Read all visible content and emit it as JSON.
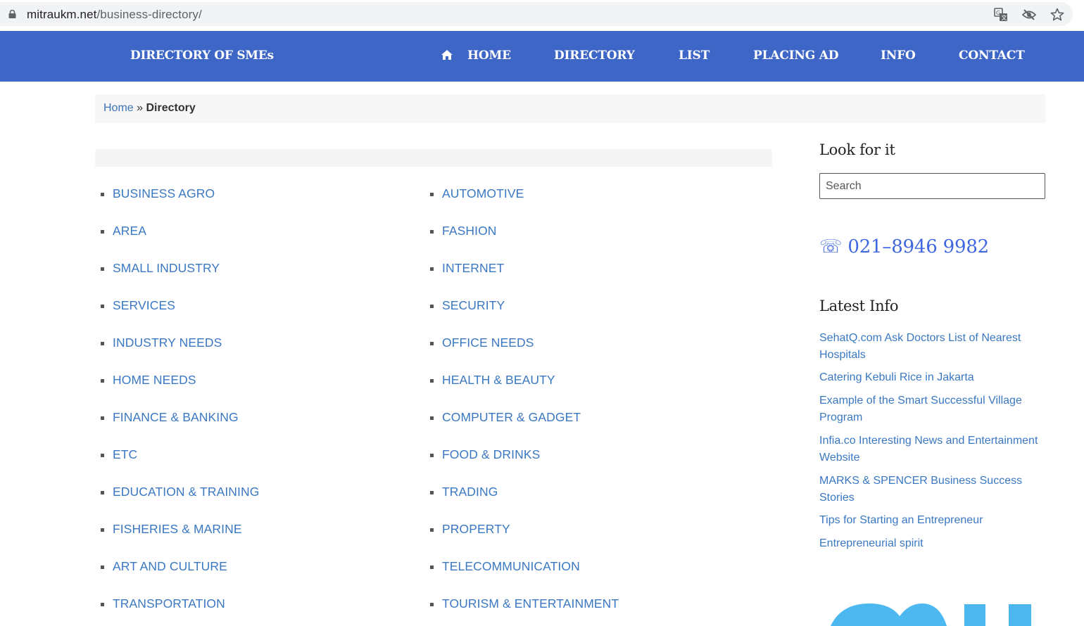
{
  "browser": {
    "url_domain": "mitraukm.net",
    "url_path": "/business-directory/"
  },
  "header": {
    "site_title": "DIRECTORY OF SMEs",
    "nav": [
      "HOME",
      "DIRECTORY",
      "LIST",
      "PLACING AD",
      "INFO",
      "CONTACT"
    ]
  },
  "breadcrumb": {
    "home": "Home",
    "separator": "»",
    "current": "Directory"
  },
  "categories": {
    "left": [
      "BUSINESS AGRO",
      "AREA",
      "SMALL INDUSTRY",
      "SERVICES",
      "INDUSTRY NEEDS",
      "HOME NEEDS",
      "FINANCE & BANKING",
      "ETC",
      "EDUCATION & TRAINING",
      "FISHERIES & MARINE",
      "ART AND CULTURE",
      "TRANSPORTATION"
    ],
    "right": [
      "AUTOMOTIVE",
      "FASHION",
      "INTERNET",
      "SECURITY",
      "OFFICE NEEDS",
      "HEALTH & BEAUTY",
      "COMPUTER & GADGET",
      "FOOD & DRINKS",
      "TRADING",
      "PROPERTY",
      "TELECOMMUNICATION",
      "TOURISM & ENTERTAINMENT"
    ]
  },
  "sidebar": {
    "search_title": "Look for it",
    "search_placeholder": "Search",
    "phone": "☏ 021–8946 9982",
    "latest_title": "Latest Info",
    "latest_items": [
      "SehatQ.com Ask Doctors List of Nearest Hospitals",
      "Catering Kebuli Rice in Jakarta",
      "Example of the Smart Successful Village Program",
      "Infia.co Interesting News and Entertainment Website",
      "MARKS & SPENCER Business Success Stories",
      "Tips for Starting an Entrepreneur",
      "Entrepreneurial spirit"
    ]
  },
  "colors": {
    "header_bg": "#3e66c7",
    "link": "#3a78c2",
    "phone": "#3e66e0",
    "logo": "#4db8f0"
  }
}
